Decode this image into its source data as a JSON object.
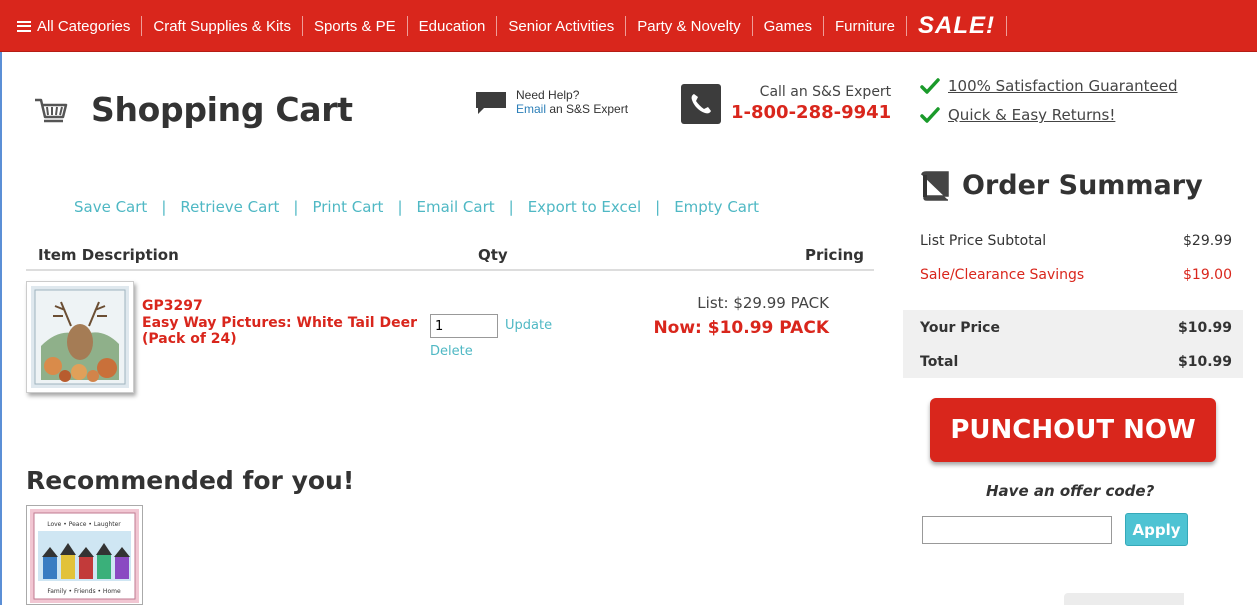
{
  "nav": {
    "all_categories": "All Categories",
    "items": [
      "Craft Supplies & Kits",
      "Sports & PE",
      "Education",
      "Senior Activities",
      "Party & Novelty",
      "Games",
      "Furniture"
    ],
    "sale": "SALE!"
  },
  "header": {
    "title": "Shopping Cart",
    "help_line1": "Need Help?",
    "help_link": "Email",
    "help_line2_rest": " an S&S Expert",
    "call_label": "Call an S&S Expert",
    "phone": "1-800-288-9941"
  },
  "cart_actions": [
    "Save Cart",
    "Retrieve Cart",
    "Print Cart",
    "Email Cart",
    "Export to Excel",
    "Empty Cart"
  ],
  "table": {
    "headers": {
      "description": "Item Description",
      "qty": "Qty",
      "pricing": "Pricing"
    },
    "items": [
      {
        "code": "GP3297",
        "name": "Easy Way Pictures: White Tail Deer (Pack of 24)",
        "qty": "1",
        "update_label": "Update",
        "delete_label": "Delete",
        "list_price": "List: $29.99 PACK",
        "now_price": "Now: $10.99 PACK"
      }
    ]
  },
  "recommended": {
    "title": "Recommended for you!",
    "thumb_top_text": "Love • Peace • Laughter",
    "thumb_bottom_text": "Family • Friends • Home"
  },
  "guarantees": [
    "100% Satisfaction Guaranteed",
    "Quick & Easy Returns!"
  ],
  "summary": {
    "title": "Order Summary",
    "list_label": "List Price Subtotal",
    "list_value": "$29.99",
    "savings_label": "Sale/Clearance Savings",
    "savings_value": "$19.00",
    "your_price_label": "Your Price",
    "your_price_value": "$10.99",
    "total_label": "Total",
    "total_value": "$10.99"
  },
  "punchout_label": "PUNCHOUT NOW",
  "offer": {
    "label": "Have an offer code?",
    "value": "",
    "apply_label": "Apply"
  },
  "colors": {
    "brand_red": "#d9261c",
    "link_teal": "#4fb8c4",
    "apply_teal": "#4ec3d3",
    "check_green": "#1a9a2a"
  }
}
